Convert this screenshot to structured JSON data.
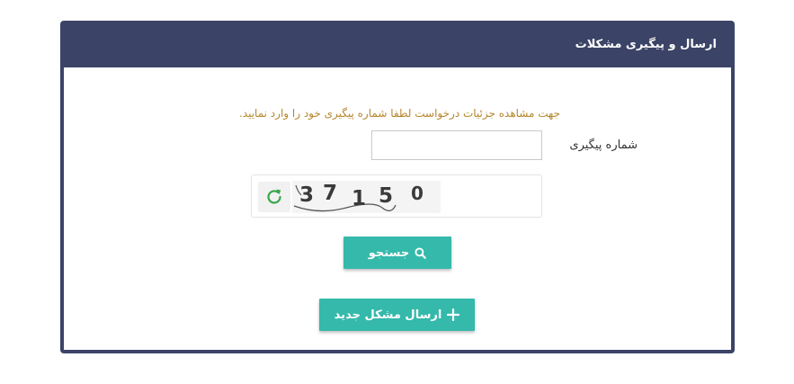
{
  "panel": {
    "title": "ارسال و پیگیری مشکلات"
  },
  "form": {
    "hint": "جهت مشاهده جزئیات درخواست لطفا شماره پیگیری خود را وارد نمایید.",
    "tracking_label": "شماره پیگیری",
    "tracking_value": "",
    "captcha_digits": [
      "3",
      "7",
      "1",
      "5",
      "0"
    ]
  },
  "buttons": {
    "search_label": "جستجو",
    "new_issue_label": "ارسال مشکل جدید"
  },
  "colors": {
    "header": "#3b4466",
    "accent": "#35b9ab",
    "hint": "#b5872e",
    "refresh": "#3aa64a"
  },
  "icons": {
    "refresh": "refresh-icon",
    "search": "search-icon",
    "new": "plus-icon"
  }
}
